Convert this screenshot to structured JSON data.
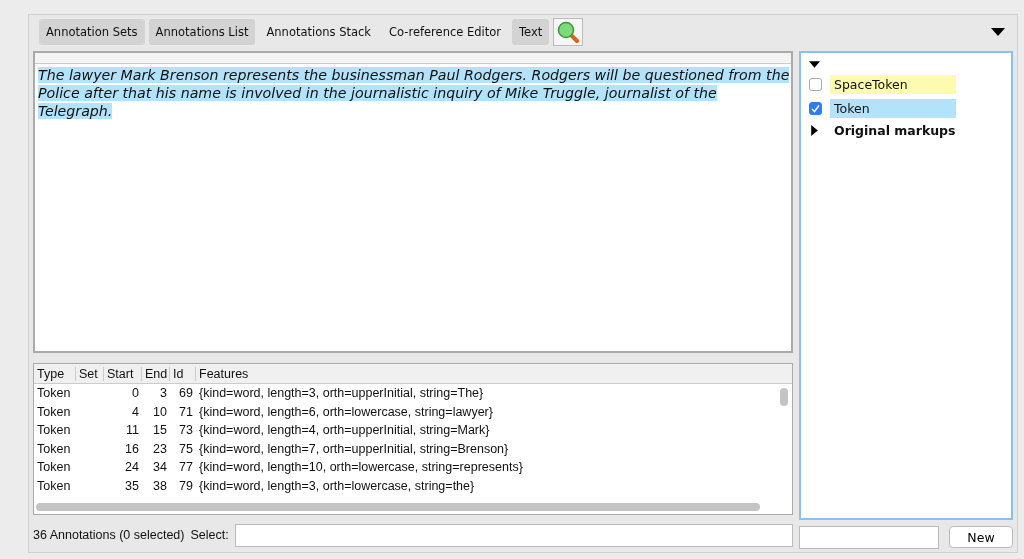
{
  "tabs": [
    {
      "label": "Annotation Sets",
      "selected": true
    },
    {
      "label": "Annotations List",
      "selected": true
    },
    {
      "label": "Annotations Stack",
      "selected": false
    },
    {
      "label": "Co-reference Editor",
      "selected": false
    },
    {
      "label": "Text",
      "selected": true
    }
  ],
  "search_button": {
    "selected": false
  },
  "text_view": {
    "text": "The lawyer Mark Brenson represents the businessman Paul Rodgers. Rodgers will be questioned from the Police after that his name is involved in the journalistic inquiry of Mike Truggle, journalist of the Telegraph.",
    "highlighted": true
  },
  "table": {
    "columns": [
      "Type",
      "Set",
      "Start",
      "End",
      "Id",
      "Features"
    ],
    "rows": [
      [
        "Token",
        "",
        "0",
        "3",
        "69",
        "{kind=word, length=3, orth=upperInitial, string=The}"
      ],
      [
        "Token",
        "",
        "4",
        "10",
        "71",
        "{kind=word, length=6, orth=lowercase, string=lawyer}"
      ],
      [
        "Token",
        "",
        "11",
        "15",
        "73",
        "{kind=word, length=4, orth=upperInitial, string=Mark}"
      ],
      [
        "Token",
        "",
        "16",
        "23",
        "75",
        "{kind=word, length=7, orth=upperInitial, string=Brenson}"
      ],
      [
        "Token",
        "",
        "24",
        "34",
        "77",
        "{kind=word, length=10, orth=lowercase, string=represents}"
      ],
      [
        "Token",
        "",
        "35",
        "38",
        "79",
        "{kind=word, length=3, orth=lowercase, string=the}"
      ]
    ]
  },
  "status": {
    "count": "36 Annotations (0 selected)",
    "select_label": "Select:"
  },
  "annotation_sets": {
    "expanded": true,
    "items": [
      {
        "kind": "type",
        "label": "SpaceToken",
        "checked": false,
        "color": "#fdfbb0"
      },
      {
        "kind": "type",
        "label": "Token",
        "checked": true,
        "color": "#b3e3fb"
      },
      {
        "kind": "group",
        "label": "Original markups",
        "expanded": false
      }
    ]
  },
  "new_button": {
    "label": "New"
  }
}
